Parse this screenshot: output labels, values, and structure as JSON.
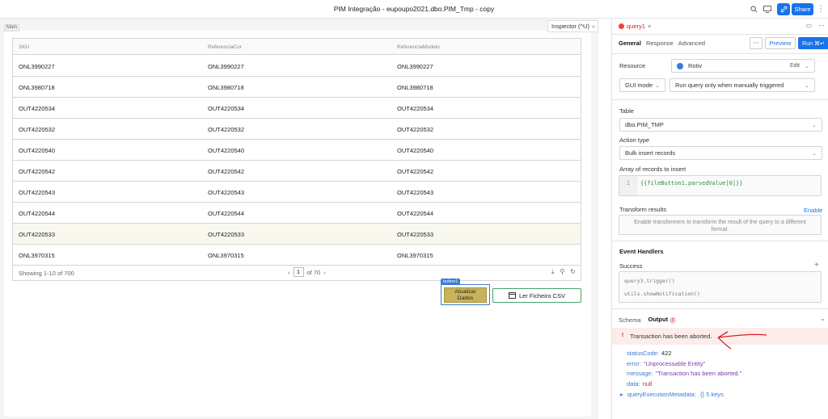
{
  "app": {
    "title": "PIM Integração - eupoupo2021.dbo.PIM_Tmp - copy",
    "share_label": "Share"
  },
  "canvas": {
    "frame_label": "Main",
    "inspector_label": "Inspector (^U)",
    "collapse_label": "«"
  },
  "table": {
    "columns": [
      "SKU",
      "ReferenciaCor",
      "ReferenciaModelo"
    ],
    "rows": [
      [
        "ONL3990227",
        "ONL3990227",
        "ONL3990227"
      ],
      [
        "ONL3980718",
        "ONL3980718",
        "ONL3980718"
      ],
      [
        "OUT4220534",
        "OUT4220534",
        "OUT4220534"
      ],
      [
        "OUT4220532",
        "OUT4220532",
        "OUT4220532"
      ],
      [
        "OUT4220540",
        "OUT4220540",
        "OUT4220540"
      ],
      [
        "OUT4220542",
        "OUT4220542",
        "OUT4220542"
      ],
      [
        "OUT4220543",
        "OUT4220543",
        "OUT4220543"
      ],
      [
        "OUT4220544",
        "OUT4220544",
        "OUT4220544"
      ],
      [
        "OUT4220533",
        "OUT4220533",
        "OUT4220533"
      ],
      [
        "ONL3970315",
        "ONL3970315",
        "ONL3970315"
      ]
    ],
    "showing": "Showing 1-10 of 700",
    "page": "1",
    "of_pages": "of 70"
  },
  "buttons": {
    "selected_tag": "button1",
    "atualizar_line1": "Atualizar",
    "atualizar_line2": "Dados",
    "ler_label": "Ler Ficheiro CSV"
  },
  "panel": {
    "query_name": "query1",
    "tabs": [
      "General",
      "Response",
      "Advanced"
    ],
    "preview_label": "Preview",
    "run_label": "Run ⌘↵",
    "resource_label": "Resource",
    "resource_value": "Rotiv",
    "edit_label": "Edit",
    "mode_value": "GUI mode",
    "trigger_value": "Run query only when manually triggered",
    "table_label": "Table",
    "table_value": "dbo.PIM_TMP",
    "action_label": "Action type",
    "action_value": "Bulk insert records",
    "array_label": "Array of records to insert",
    "code_line_no": "1",
    "code": "{{fileButton1.parsedValue[0]}}",
    "transform_label": "Transform results",
    "enable_label": "Enable",
    "transform_hint_1": "Enable transformers to transform the result of the query to a different",
    "transform_hint_2": "format.",
    "handlers_label": "Event Handlers",
    "success_label": "Success",
    "handler_1": "query3.trigger()",
    "handler_2": "utils.showNotification()"
  },
  "output": {
    "schema_tab": "Schema",
    "output_tab": "Output",
    "error_message": "Transaction has been aborted.",
    "fields": [
      {
        "key": "statusCode:",
        "value": "422"
      },
      {
        "key": "error:",
        "value": "\"Unprocessable Entity\""
      },
      {
        "key": "message:",
        "value": "\"Transaction has been aborted.\""
      },
      {
        "key": "data:",
        "value": "null"
      }
    ],
    "meta_key": "queryExecutionMetadata:",
    "meta_value": "{} 5 keys"
  },
  "colors": {
    "accent": "#1a73e8",
    "error": "#cc2222",
    "button_gold": "#c8b35a",
    "button_green_border": "#4aa06a"
  }
}
